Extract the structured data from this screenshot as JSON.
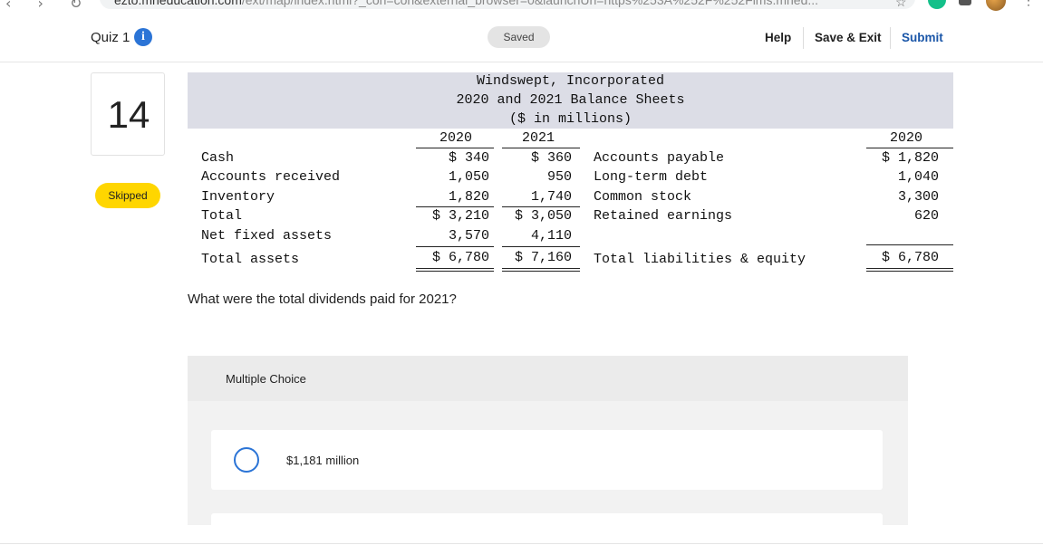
{
  "browser": {
    "nav_glyphs": "‹ › ↻",
    "url_host": "ezto.mheducation.com",
    "url_path": "/ext/map/index.html?_con=con&external_browser=0&launchUrl=https%253A%252F%252Flms.mhed..."
  },
  "header": {
    "quiz_title": "Quiz 1",
    "info_glyph": "i",
    "saved_label": "Saved",
    "help_label": "Help",
    "save_exit_label": "Save & Exit",
    "submit_label": "Submit"
  },
  "question_nav": {
    "number": "14",
    "status": "Skipped"
  },
  "balance_sheet": {
    "title": "Windswept, Incorporated",
    "subtitle": "2020 and 2021 Balance Sheets",
    "units": "($ in millions)",
    "assets_years": [
      "2020",
      "2021"
    ],
    "liab_years": [
      "2020"
    ],
    "assets": [
      {
        "label": "Cash",
        "y2020": "$ 340",
        "y2021": "$ 360"
      },
      {
        "label": "Accounts received",
        "y2020": "1,050",
        "y2021": "950"
      },
      {
        "label": "Inventory",
        "y2020": "1,820",
        "y2021": "1,740"
      },
      {
        "label": "Total",
        "y2020": "$ 3,210",
        "y2021": "$ 3,050"
      },
      {
        "label": "Net fixed assets",
        "y2020": "3,570",
        "y2021": "4,110"
      },
      {
        "label": "Total assets",
        "y2020": "$ 6,780",
        "y2021": "$ 7,160"
      }
    ],
    "liabilities": [
      {
        "label": "Accounts payable",
        "y2020": "$ 1,820"
      },
      {
        "label": "Long-term debt",
        "y2020": "1,040"
      },
      {
        "label": "Common stock",
        "y2020": "3,300"
      },
      {
        "label": "Retained earnings",
        "y2020": "620"
      },
      {
        "label": "Total liabilities & equity",
        "y2020": "$ 6,780"
      }
    ]
  },
  "question_text": "What were the total dividends paid for 2021?",
  "multiple_choice": {
    "label": "Multiple Choice",
    "options": [
      "$1,181 million"
    ]
  }
}
